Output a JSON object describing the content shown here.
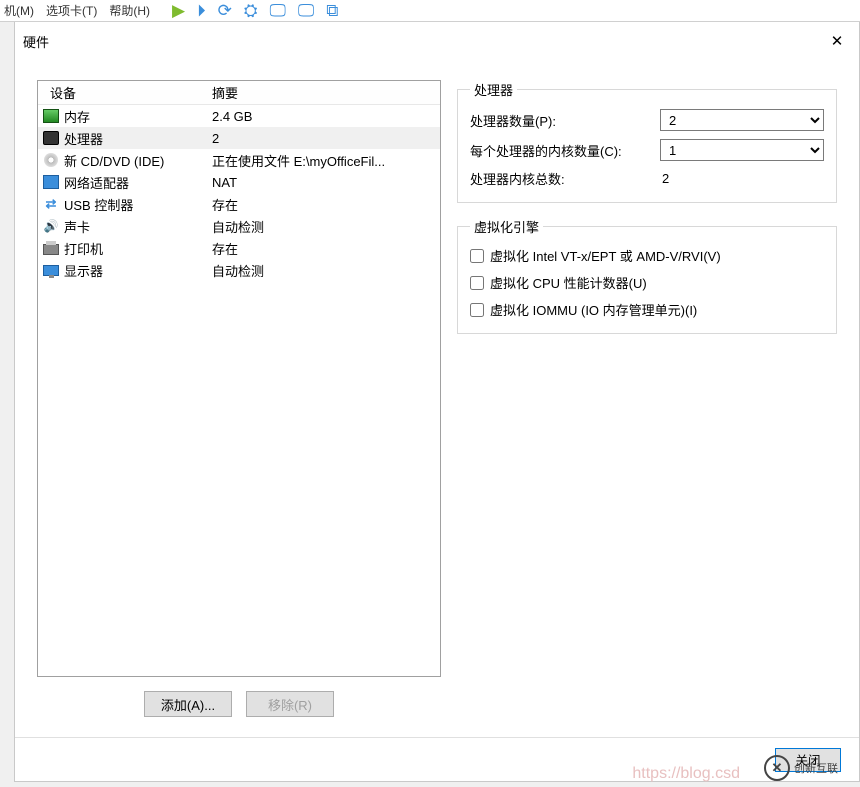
{
  "menu": {
    "items": [
      "机(M)",
      "选项卡(T)",
      "帮助(H)"
    ]
  },
  "dialog": {
    "title": "硬件",
    "close_label": "关闭"
  },
  "device_list": {
    "header_device": "设备",
    "header_summary": "摘要",
    "rows": [
      {
        "icon": "mem",
        "name": "内存",
        "summary": "2.4 GB"
      },
      {
        "icon": "cpu",
        "name": "处理器",
        "summary": "2",
        "selected": true
      },
      {
        "icon": "cd",
        "name": "新 CD/DVD (IDE)",
        "summary": "正在使用文件 E:\\myOfficeFil..."
      },
      {
        "icon": "net",
        "name": "网络适配器",
        "summary": "NAT"
      },
      {
        "icon": "usb",
        "name": "USB 控制器",
        "summary": "存在"
      },
      {
        "icon": "snd",
        "name": "声卡",
        "summary": "自动检测"
      },
      {
        "icon": "prn",
        "name": "打印机",
        "summary": "存在"
      },
      {
        "icon": "disp",
        "name": "显示器",
        "summary": "自动检测"
      }
    ],
    "add_label": "添加(A)...",
    "remove_label": "移除(R)"
  },
  "processors": {
    "group_label": "处理器",
    "count_label": "处理器数量(P):",
    "count_value": "2",
    "cores_label": "每个处理器的内核数量(C):",
    "cores_value": "1",
    "total_label": "处理器内核总数:",
    "total_value": "2"
  },
  "virtualization": {
    "group_label": "虚拟化引擎",
    "opt1": "虚拟化 Intel VT-x/EPT 或 AMD-V/RVI(V)",
    "opt2": "虚拟化 CPU 性能计数器(U)",
    "opt3": "虚拟化 IOMMU (IO 内存管理单元)(I)"
  },
  "brand": "创新互联",
  "watermark": "https://blog.csd"
}
